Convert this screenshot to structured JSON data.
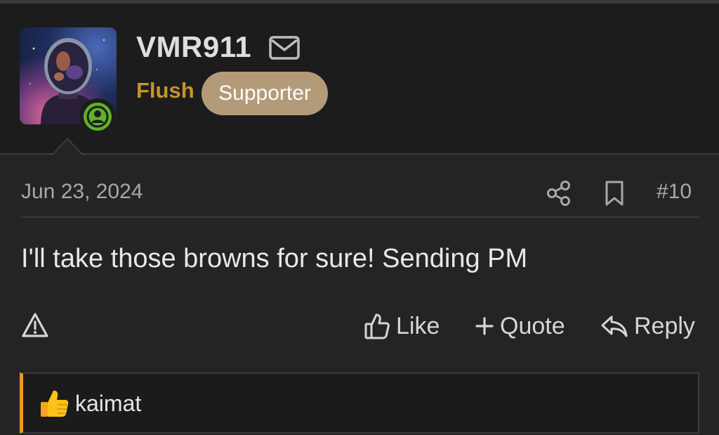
{
  "post": {
    "username": "VMR911",
    "user_title": "Flush",
    "badge": "Supporter",
    "date": "Jun 23, 2024",
    "number": "#10",
    "body": "I'll take those browns for sure! Sending PM"
  },
  "actions": {
    "like": "Like",
    "quote": "Quote",
    "reply": "Reply"
  },
  "reactions": {
    "users": "kaimat"
  },
  "colors": {
    "accent_orange": "#e89a1d",
    "user_title": "#c9932a",
    "badge_bg": "#b39a79",
    "online_green": "#5fb227"
  },
  "icons": [
    "mail-icon",
    "online-user-icon",
    "share-icon",
    "bookmark-icon",
    "report-icon",
    "thumbs-up-icon",
    "plus-icon",
    "reply-icon",
    "thumbs-up-emoji-icon"
  ]
}
